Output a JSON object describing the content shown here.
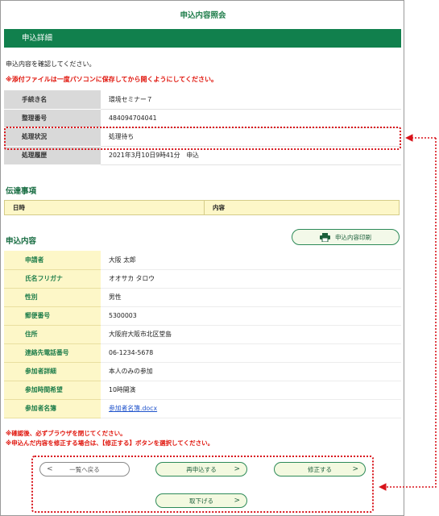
{
  "page": {
    "title": "申込内容照会",
    "section_title": "申込詳細",
    "intro": "申込内容を確認してください。",
    "warning": "※添付ファイルは一度パソコンに保存してから開くようにしてください。"
  },
  "details": [
    {
      "label": "手続き名",
      "value": "環境セミナー７"
    },
    {
      "label": "整理番号",
      "value": "484094704041"
    },
    {
      "label": "処理状況",
      "value": "処理待ち"
    },
    {
      "label": "処理履歴",
      "value": "2021年3月10日9時41分　申込"
    }
  ],
  "communication": {
    "heading": "伝達事項",
    "col_date": "日時",
    "col_content": "内容"
  },
  "application": {
    "heading": "申込内容",
    "print_label": "申込内容印刷",
    "rows": [
      {
        "label": "申請者",
        "value": "大阪 太郎"
      },
      {
        "label": "氏名フリガナ",
        "value": "オオサカ タロウ"
      },
      {
        "label": "性別",
        "value": "男性"
      },
      {
        "label": "郵便番号",
        "value": "5300003"
      },
      {
        "label": "住所",
        "value": "大阪府大阪市北区堂島"
      },
      {
        "label": "連絡先電話番号",
        "value": "06-1234-5678"
      },
      {
        "label": "参加者詳細",
        "value": "本人のみの参加"
      },
      {
        "label": "参加時間希望",
        "value": "10時開演"
      },
      {
        "label": "参加者名簿",
        "value": "参加者名簿.docx"
      }
    ]
  },
  "notes": {
    "line1": "※確認後、必ずブラウザを閉じてください。",
    "line2": "※申込んだ内容を修正する場合は、【修正する】ボタンを選択してください。"
  },
  "buttons": {
    "back": "一覧へ戻る",
    "reapply": "再申込する",
    "modify": "修正する",
    "withdraw": "取下げる"
  },
  "colors": {
    "accent_green": "#11804d",
    "highlight_red": "#d8141b",
    "label_yellow": "#fdf7c8"
  }
}
